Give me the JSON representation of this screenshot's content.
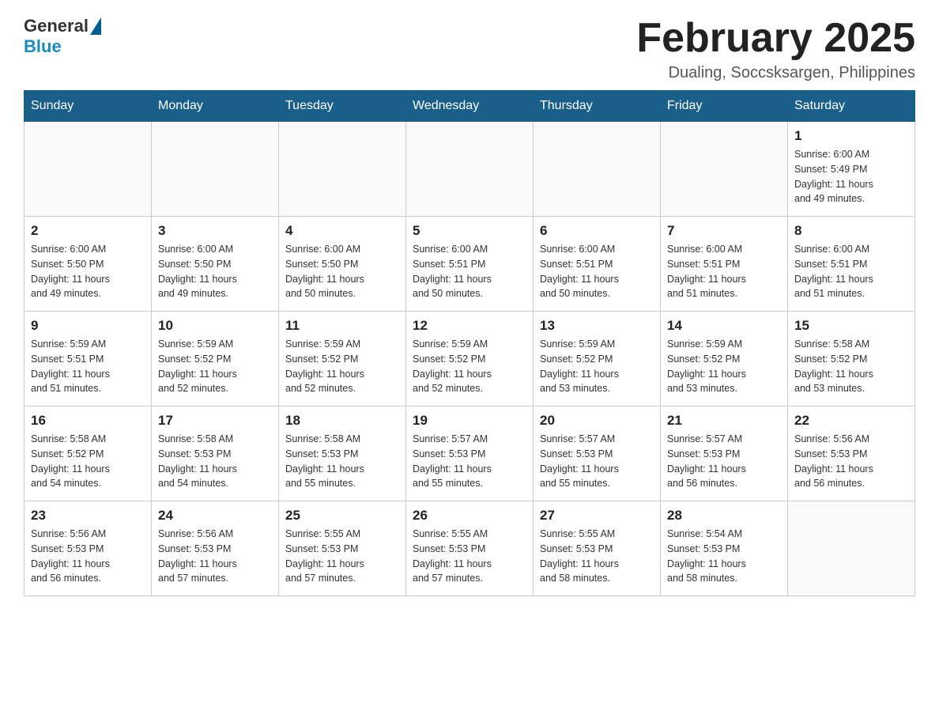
{
  "logo": {
    "general": "General",
    "blue": "Blue"
  },
  "header": {
    "month_title": "February 2025",
    "location": "Dualing, Soccsksargen, Philippines"
  },
  "weekdays": [
    "Sunday",
    "Monday",
    "Tuesday",
    "Wednesday",
    "Thursday",
    "Friday",
    "Saturday"
  ],
  "weeks": [
    [
      {
        "day": "",
        "info": ""
      },
      {
        "day": "",
        "info": ""
      },
      {
        "day": "",
        "info": ""
      },
      {
        "day": "",
        "info": ""
      },
      {
        "day": "",
        "info": ""
      },
      {
        "day": "",
        "info": ""
      },
      {
        "day": "1",
        "info": "Sunrise: 6:00 AM\nSunset: 5:49 PM\nDaylight: 11 hours\nand 49 minutes."
      }
    ],
    [
      {
        "day": "2",
        "info": "Sunrise: 6:00 AM\nSunset: 5:50 PM\nDaylight: 11 hours\nand 49 minutes."
      },
      {
        "day": "3",
        "info": "Sunrise: 6:00 AM\nSunset: 5:50 PM\nDaylight: 11 hours\nand 49 minutes."
      },
      {
        "day": "4",
        "info": "Sunrise: 6:00 AM\nSunset: 5:50 PM\nDaylight: 11 hours\nand 50 minutes."
      },
      {
        "day": "5",
        "info": "Sunrise: 6:00 AM\nSunset: 5:51 PM\nDaylight: 11 hours\nand 50 minutes."
      },
      {
        "day": "6",
        "info": "Sunrise: 6:00 AM\nSunset: 5:51 PM\nDaylight: 11 hours\nand 50 minutes."
      },
      {
        "day": "7",
        "info": "Sunrise: 6:00 AM\nSunset: 5:51 PM\nDaylight: 11 hours\nand 51 minutes."
      },
      {
        "day": "8",
        "info": "Sunrise: 6:00 AM\nSunset: 5:51 PM\nDaylight: 11 hours\nand 51 minutes."
      }
    ],
    [
      {
        "day": "9",
        "info": "Sunrise: 5:59 AM\nSunset: 5:51 PM\nDaylight: 11 hours\nand 51 minutes."
      },
      {
        "day": "10",
        "info": "Sunrise: 5:59 AM\nSunset: 5:52 PM\nDaylight: 11 hours\nand 52 minutes."
      },
      {
        "day": "11",
        "info": "Sunrise: 5:59 AM\nSunset: 5:52 PM\nDaylight: 11 hours\nand 52 minutes."
      },
      {
        "day": "12",
        "info": "Sunrise: 5:59 AM\nSunset: 5:52 PM\nDaylight: 11 hours\nand 52 minutes."
      },
      {
        "day": "13",
        "info": "Sunrise: 5:59 AM\nSunset: 5:52 PM\nDaylight: 11 hours\nand 53 minutes."
      },
      {
        "day": "14",
        "info": "Sunrise: 5:59 AM\nSunset: 5:52 PM\nDaylight: 11 hours\nand 53 minutes."
      },
      {
        "day": "15",
        "info": "Sunrise: 5:58 AM\nSunset: 5:52 PM\nDaylight: 11 hours\nand 53 minutes."
      }
    ],
    [
      {
        "day": "16",
        "info": "Sunrise: 5:58 AM\nSunset: 5:52 PM\nDaylight: 11 hours\nand 54 minutes."
      },
      {
        "day": "17",
        "info": "Sunrise: 5:58 AM\nSunset: 5:53 PM\nDaylight: 11 hours\nand 54 minutes."
      },
      {
        "day": "18",
        "info": "Sunrise: 5:58 AM\nSunset: 5:53 PM\nDaylight: 11 hours\nand 55 minutes."
      },
      {
        "day": "19",
        "info": "Sunrise: 5:57 AM\nSunset: 5:53 PM\nDaylight: 11 hours\nand 55 minutes."
      },
      {
        "day": "20",
        "info": "Sunrise: 5:57 AM\nSunset: 5:53 PM\nDaylight: 11 hours\nand 55 minutes."
      },
      {
        "day": "21",
        "info": "Sunrise: 5:57 AM\nSunset: 5:53 PM\nDaylight: 11 hours\nand 56 minutes."
      },
      {
        "day": "22",
        "info": "Sunrise: 5:56 AM\nSunset: 5:53 PM\nDaylight: 11 hours\nand 56 minutes."
      }
    ],
    [
      {
        "day": "23",
        "info": "Sunrise: 5:56 AM\nSunset: 5:53 PM\nDaylight: 11 hours\nand 56 minutes."
      },
      {
        "day": "24",
        "info": "Sunrise: 5:56 AM\nSunset: 5:53 PM\nDaylight: 11 hours\nand 57 minutes."
      },
      {
        "day": "25",
        "info": "Sunrise: 5:55 AM\nSunset: 5:53 PM\nDaylight: 11 hours\nand 57 minutes."
      },
      {
        "day": "26",
        "info": "Sunrise: 5:55 AM\nSunset: 5:53 PM\nDaylight: 11 hours\nand 57 minutes."
      },
      {
        "day": "27",
        "info": "Sunrise: 5:55 AM\nSunset: 5:53 PM\nDaylight: 11 hours\nand 58 minutes."
      },
      {
        "day": "28",
        "info": "Sunrise: 5:54 AM\nSunset: 5:53 PM\nDaylight: 11 hours\nand 58 minutes."
      },
      {
        "day": "",
        "info": ""
      }
    ]
  ]
}
